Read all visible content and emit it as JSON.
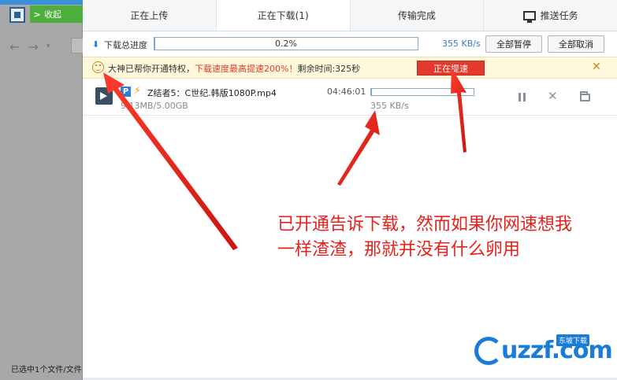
{
  "left_app": {
    "collapse_label": "收起",
    "status_text": "已选中1个文件/文件"
  },
  "tabs": [
    {
      "label": "正在上传"
    },
    {
      "label": "正在下载(1)"
    },
    {
      "label": "传输完成"
    },
    {
      "label": "推送任务"
    }
  ],
  "progress": {
    "label": "下载总进度",
    "percent_text": "0.2%",
    "fraction": 0.002,
    "speed": "355 KB/s",
    "pause_all": "全部暂停",
    "cancel_all": "全部取消"
  },
  "notice": {
    "text_a": "大神已帮你开通特权，",
    "text_b": "下载速度最高提速200%！",
    "text_c": "剩余时间:325秒",
    "speedup_button": "正在提速"
  },
  "task": {
    "badge": "P",
    "name": "Z结者5：C世纪.韩版1080P.mp4",
    "size": "9.13MB/5.00GB",
    "eta": "04:46:01",
    "progress_fraction": 0.002,
    "speed": "355 KB/s"
  },
  "annotation": {
    "line1": "已开通告诉下载，然而如果你网速想我",
    "line2": "一样渣渣，那就并没有什么卵用"
  },
  "watermark": {
    "text": "uzzf.com",
    "tag": "东坡下载"
  },
  "colors": {
    "accent_blue": "#2f7fd6",
    "alert_red": "#e6392d",
    "notice_bg": "#fff8dc"
  }
}
